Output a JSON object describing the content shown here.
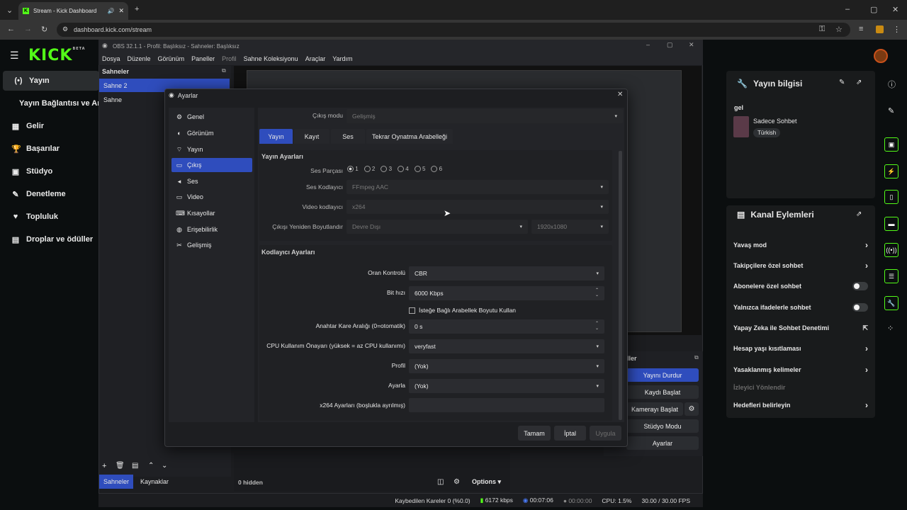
{
  "browser": {
    "tab_title": "Stream - Kick Dashboard",
    "url": "dashboard.kick.com/stream"
  },
  "kick": {
    "logo": "KICK",
    "logo_badge": "BETA",
    "nav": [
      {
        "label": "Yayın",
        "icon": "broadcast-icon"
      },
      {
        "label": "Yayın Bağlantısı ve Anahtar"
      },
      {
        "label": "Gelir",
        "icon": "revenue-icon"
      },
      {
        "label": "Başarılar",
        "icon": "trophy-icon"
      },
      {
        "label": "Stüdyo",
        "icon": "studio-icon"
      },
      {
        "label": "Denetleme",
        "icon": "moderation-icon"
      },
      {
        "label": "Topluluk",
        "icon": "community-icon"
      },
      {
        "label": "Droplar ve ödüller",
        "icon": "drops-icon"
      }
    ],
    "stream_info": {
      "title": "Yayın bilgisi",
      "stream_title": "gel",
      "category": "Sadece Sohbet",
      "language_tag": "Türkish"
    },
    "channel_actions": {
      "title": "Kanal Eylemleri",
      "items": [
        {
          "label": "Yavaş mod",
          "control": "chevron"
        },
        {
          "label": "Takipçilere özel sohbet",
          "control": "chevron"
        },
        {
          "label": "Abonelere özel sohbet",
          "control": "toggle"
        },
        {
          "label": "Yalnızca ifadelerle sohbet",
          "control": "toggle"
        },
        {
          "label": "Yapay Zeka ile Sohbet Denetimi",
          "control": "external"
        },
        {
          "label": "Hesap yaşı kısıtlaması",
          "control": "chevron"
        },
        {
          "label": "Yasaklanmış kelimeler",
          "control": "chevron"
        },
        {
          "label": "İzleyici Yönlendir",
          "control": "none"
        },
        {
          "label": "Hedefleri belirleyin",
          "control": "chevron"
        }
      ]
    }
  },
  "obs": {
    "title": "OBS 32.1.1 - Profil: Başlıksız - Sahneler: Başlıksız",
    "menu": [
      "Dosya",
      "Düzenle",
      "Görünüm",
      "Paneller",
      "Profil",
      "Sahne Koleksiyonu",
      "Araçlar",
      "Yardım"
    ],
    "scenes_title": "Sahneler",
    "scenes": [
      "Sahne 2",
      "Sahne"
    ],
    "bottom_tabs": [
      "Sahneler",
      "Kaynaklar"
    ],
    "hidden_label": "0 hidden",
    "options_label": "Options",
    "controls_title": "ller",
    "controls": [
      "Yayını Durdur",
      "Kaydı Başlat",
      "Kamerayı Başlat",
      "Stüdyo Modu",
      "Ayarlar"
    ],
    "status": {
      "dropped": "Kaybedilen Kareler 0 (%0.0)",
      "bitrate": "6172 kbps",
      "stream_time": "00:07:06",
      "rec_time": "00:00:00",
      "cpu": "CPU: 1.5%",
      "fps": "30.00 / 30.00 FPS"
    }
  },
  "settings": {
    "title": "Ayarlar",
    "categories": [
      "Genel",
      "Görünüm",
      "Yayın",
      "Çıkış",
      "Ses",
      "Video",
      "Kısayollar",
      "Erişebilirlik",
      "Gelişmiş"
    ],
    "output_mode_label": "Çıkış modu",
    "output_mode_value": "Gelişmiş",
    "tabs": [
      "Yayın",
      "Kayıt",
      "Ses",
      "Tekrar Oynatma Arabelleği"
    ],
    "stream_section": {
      "title": "Yayın Ayarları",
      "audio_track_label": "Ses Parçası",
      "audio_tracks": [
        "1",
        "2",
        "3",
        "4",
        "5",
        "6"
      ],
      "audio_encoder_label": "Ses Kodlayıcı",
      "audio_encoder_value": "FFmpeg AAC",
      "video_encoder_label": "Video kodlayıcı",
      "video_encoder_value": "x264",
      "rescale_label": "Çıkışı Yeniden Boyutlandır",
      "rescale_value": "Devre Dışı",
      "rescale_resolution": "1920x1080"
    },
    "encoder_section": {
      "title": "Kodlayıcı Ayarları",
      "rate_control_label": "Oran Kontrolü",
      "rate_control_value": "CBR",
      "bitrate_label": "Bit hızı",
      "bitrate_value": "6000 Kbps",
      "custom_buffer_label": "İsteğe Bağlı Arabellek Boyutu Kullan",
      "keyframe_label": "Anahtar Kare Aralığı (0=otomatik)",
      "keyframe_value": "0 s",
      "cpu_preset_label": "CPU Kullanım Önayarı (yüksek = az CPU kullanımı)",
      "cpu_preset_value": "veryfast",
      "profile_label": "Profil",
      "profile_value": "(Yok)",
      "tune_label": "Ayarla",
      "tune_value": "(Yok)",
      "x264_opts_label": "x264 Ayarları (boşlukla ayrılmış)",
      "x264_opts_value": ""
    },
    "buttons": {
      "ok": "Tamam",
      "cancel": "İptal",
      "apply": "Uygula"
    }
  }
}
